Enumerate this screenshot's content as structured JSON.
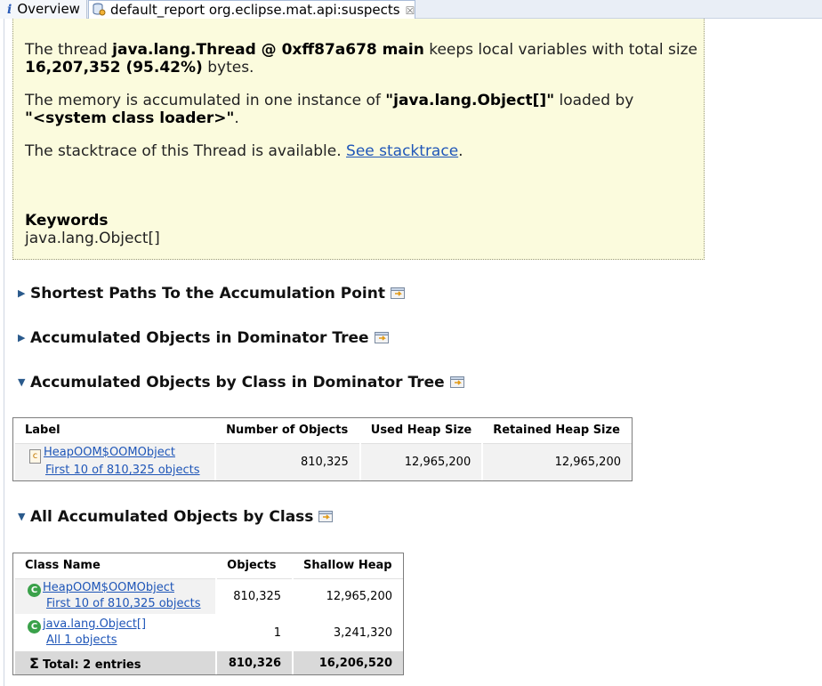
{
  "tabs": [
    {
      "icon": "info-icon",
      "label": "Overview"
    },
    {
      "icon": "database-icon",
      "label": "default_report  org.eclipse.mat.api:suspects",
      "close": "☒"
    }
  ],
  "description": {
    "line1_pre": "The thread ",
    "line1_bold": "java.lang.Thread @ 0xff87a678 main",
    "line1_post": " keeps local variables with total size",
    "line2_bold": "16,207,352 (95.42%)",
    "line2_post": " bytes.",
    "line3_pre": "The memory is accumulated in one instance of ",
    "line3_bold": "\"java.lang.Object[]\"",
    "line3_post": " loaded by",
    "line4_bold": "\"<system class loader>\"",
    "line4_post": ".",
    "line5_pre": "The stacktrace of this Thread is available. ",
    "line5_link": "See stacktrace",
    "line5_post": ".",
    "keywords_heading": "Keywords",
    "keywords_value": "java.lang.Object[]"
  },
  "sections": [
    {
      "title": "Shortest Paths To the Accumulation Point",
      "expanded": false
    },
    {
      "title": "Accumulated Objects in Dominator Tree",
      "expanded": false
    },
    {
      "title": "Accumulated Objects by Class in Dominator Tree",
      "expanded": true
    },
    {
      "title": "All Accumulated Objects by Class",
      "expanded": true
    }
  ],
  "dominator_table": {
    "headers": [
      "Label",
      "Number of Objects",
      "Used Heap Size",
      "Retained Heap Size"
    ],
    "rows": [
      {
        "label": "HeapOOM$OOMObject",
        "sublabel": "First 10 of 810,325 objects",
        "objects": "810,325",
        "used": "12,965,200",
        "retained": "12,965,200"
      }
    ]
  },
  "class_table": {
    "headers": [
      "Class Name",
      "Objects",
      "Shallow Heap"
    ],
    "rows": [
      {
        "label": "HeapOOM$OOMObject",
        "sublabel": "First 10 of 810,325 objects",
        "objects": "810,325",
        "shallow": "12,965,200"
      },
      {
        "label": "java.lang.Object[]",
        "sublabel": "All 1 objects",
        "objects": "1",
        "shallow": "3,241,320"
      }
    ],
    "total": {
      "label": "Total: 2 entries",
      "objects": "810,326",
      "shallow": "16,206,520"
    }
  },
  "colors": {
    "accent": "#1f56b8",
    "desc_bg": "#fbfbdd",
    "class_icon": "#3aa14a"
  }
}
